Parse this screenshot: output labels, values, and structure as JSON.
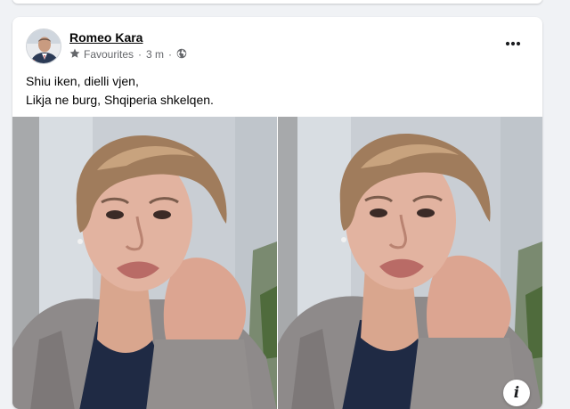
{
  "post": {
    "author": "Romeo Kara",
    "audience_label": "Favourites",
    "timestamp": "3 m",
    "separator": "·",
    "audience_icon": "star-icon",
    "privacy_icon": "globe-icon",
    "more_icon": "more-options-icon",
    "text_lines": [
      "Shiu iken, dielli vjen,",
      "Likja ne burg, Shqiperia shkelqen."
    ]
  },
  "media": {
    "info_label": "i"
  },
  "colors": {
    "background": "#f0f2f5",
    "card": "#ffffff",
    "primary_text": "#050505",
    "secondary_text": "#65676b"
  }
}
